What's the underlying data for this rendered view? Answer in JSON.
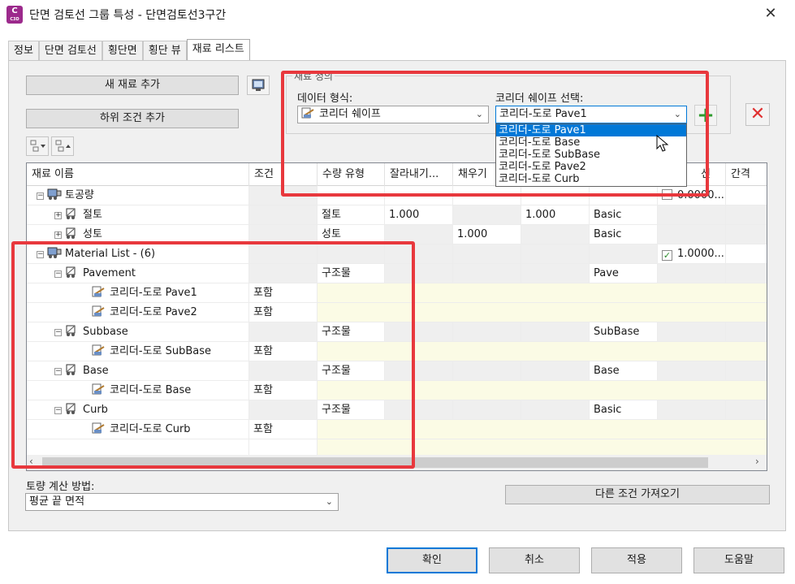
{
  "window": {
    "title": "단면 검토선 그룹 특성 - 단면검토선3구간",
    "app_icon_letter": "C",
    "app_icon_sub": "C3D",
    "close_glyph": "✕"
  },
  "tabs": [
    {
      "label": "정보",
      "active": false
    },
    {
      "label": "단면 검토선",
      "active": false
    },
    {
      "label": "횡단면",
      "active": false
    },
    {
      "label": "횡단 뷰",
      "active": false
    },
    {
      "label": "재료 리스트",
      "active": true
    }
  ],
  "toolbar": {
    "add_material": "새 재료 추가",
    "add_subcriteria": "하위 조건 추가"
  },
  "material_definition": {
    "legend": "재료 정의",
    "data_type_label": "데이터 형식:",
    "data_type_value": "코리더 쉐이프",
    "shape_label": "코리더 쉐이프 선택:",
    "shape_value": "코리더-도로 Pave1",
    "shape_options": [
      "코리더-도로 Pave1",
      "코리더-도로 Base",
      "코리더-도로 SubBase",
      "코리더-도로 Pave2",
      "코리더-도로 Curb"
    ],
    "add_icon": "+",
    "delete_icon": "✕"
  },
  "grid": {
    "columns": [
      "재료 이름",
      "조건",
      "수량 유형",
      "잘라내기...",
      "채우기",
      "",
      "",
      "선",
      "간격"
    ],
    "rows": [
      {
        "name": "토공량",
        "condition": "",
        "qty": "",
        "cut": "",
        "fill": "",
        "refill": "",
        "shape": "",
        "check": "0.0000...",
        "checked": false
      },
      {
        "name": "절토",
        "qty": "절토",
        "cut": "1.000",
        "fill": "",
        "refill": "1.000",
        "shape": "Basic"
      },
      {
        "name": "성토",
        "qty": "성토",
        "cut": "",
        "fill": "1.000",
        "refill": "",
        "shape": "Basic"
      },
      {
        "name": "Material List - (6)",
        "check": "1.0000...",
        "checked": true
      },
      {
        "name": "Pavement",
        "qty": "구조물",
        "shape": "Pave"
      },
      {
        "name": "코리더-도로 Pave1",
        "condition": "포함"
      },
      {
        "name": "코리더-도로 Pave2",
        "condition": "포함"
      },
      {
        "name": "Subbase",
        "qty": "구조물",
        "shape": "SubBase"
      },
      {
        "name": "코리더-도로 SubBase",
        "condition": "포함"
      },
      {
        "name": "Base",
        "qty": "구조물",
        "shape": "Base"
      },
      {
        "name": "코리더-도로 Base",
        "condition": "포함"
      },
      {
        "name": "Curb",
        "qty": "구조물",
        "shape": "Basic"
      },
      {
        "name": "코리더-도로 Curb",
        "condition": "포함"
      }
    ]
  },
  "bottom": {
    "method_label": "토량 계산 방법:",
    "method_value": "평균 끝 면적",
    "import_button": "다른 조건 가져오기"
  },
  "footer": {
    "ok": "확인",
    "cancel": "취소",
    "apply": "적용",
    "help": "도움말"
  },
  "colors": {
    "annotation_red": "#e8383d",
    "selection_blue": "#0078d7",
    "cream_row": "#fbfbe5"
  }
}
